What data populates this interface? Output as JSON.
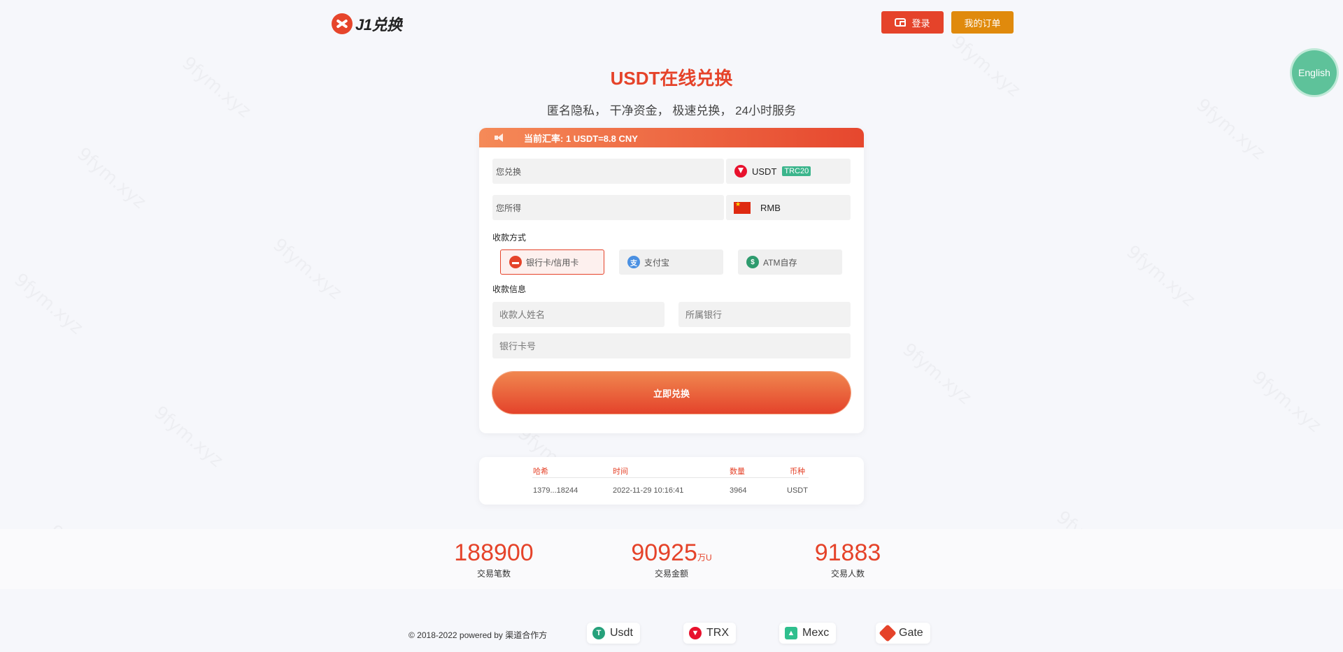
{
  "header": {
    "logo_text": "J1兑换",
    "login_label": "登录",
    "orders_label": "我的订单",
    "language_label": "English"
  },
  "hero": {
    "title": "USDT在线兑换",
    "subtitle": "匿名隐私， 干净资金， 极速兑换， 24小时服务"
  },
  "exchange": {
    "rate_text": "当前汇率: 1 USDT=8.8 CNY",
    "pay_label": "您兑换",
    "pay_currency": "USDT",
    "pay_network_badge": "TRC20",
    "receive_label": "您所得",
    "receive_currency": "RMB",
    "method_title": "收款方式",
    "methods": [
      {
        "label": "银行卡/信用卡",
        "active": true,
        "icon": "bank-card-icon",
        "color": "#e5432a"
      },
      {
        "label": "支付宝",
        "active": false,
        "icon": "alipay-icon",
        "color": "#4a90e2"
      },
      {
        "label": "ATM自存",
        "active": false,
        "icon": "atm-icon",
        "color": "#2e9b6e"
      }
    ],
    "info_title": "收款信息",
    "name_placeholder": "收款人姓名",
    "bank_placeholder": "所属银行",
    "card_placeholder": "银行卡号",
    "submit_label": "立即兑换"
  },
  "transactions": {
    "headers": [
      "哈希",
      "时间",
      "数量",
      "币种"
    ],
    "rows": [
      [
        "1379...18244",
        "2022-11-29 10:16:41",
        "3964",
        "USDT"
      ]
    ]
  },
  "stats": [
    {
      "value": "188900",
      "unit": "",
      "caption": "交易笔数"
    },
    {
      "value": "90925",
      "unit": "万U",
      "caption": "交易金额"
    },
    {
      "value": "91883",
      "unit": "",
      "caption": "交易人数"
    }
  ],
  "footer": {
    "copyright": "© 2018-2022 powered by 渠道合作方",
    "partners": [
      {
        "label": "Usdt",
        "icon": "tether-icon",
        "color": "#26a17b"
      },
      {
        "label": "TRX",
        "icon": "tron-icon",
        "color": "#e8112d"
      },
      {
        "label": "Mexc",
        "icon": "mexc-icon",
        "color": "#2fbf8e"
      },
      {
        "label": "Gate",
        "icon": "gate-icon",
        "color": "#e5432a"
      }
    ]
  },
  "colors": {
    "accent": "#e5432a",
    "orders": "#e08a0c",
    "language": "#5ec29a",
    "badge": "#3bb58c"
  }
}
